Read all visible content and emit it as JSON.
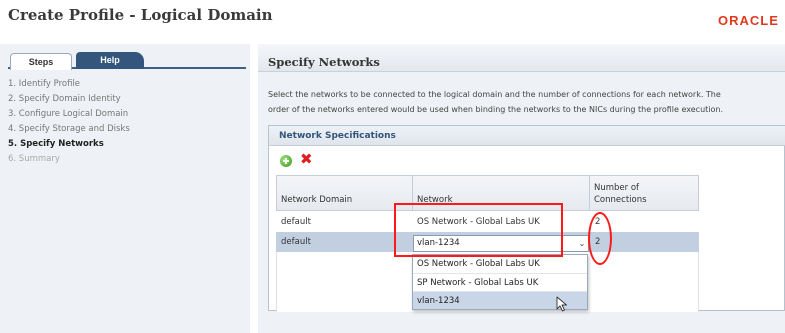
{
  "window": {
    "title": "Create Profile - Logical Domain",
    "logo": "ORACLE"
  },
  "left_panel": {
    "tabs": [
      {
        "label": "Steps",
        "selected": true
      },
      {
        "label": "Help",
        "selected": false
      }
    ],
    "steps": [
      {
        "label": "1.  Identify Profile",
        "state": "done"
      },
      {
        "label": "2.  Specify Domain Identity",
        "state": "done"
      },
      {
        "label": "3.  Configure Logical Domain",
        "state": "done"
      },
      {
        "label": "4.  Specify Storage and Disks",
        "state": "done"
      },
      {
        "label": "5.  Specify Networks",
        "state": "current"
      },
      {
        "label": "6.  Summary",
        "state": "disabled"
      }
    ]
  },
  "main": {
    "title": "Specify Networks",
    "description_line1": "Select the networks to be connected to the logical domain and the number of connections for each network. The",
    "description_line2": "order of the networks entered would be used when binding the networks to the NICs during the profile execution."
  },
  "table_panel": {
    "title": "Network Specifications",
    "toolbar": {
      "add_icon": "add-icon",
      "delete_icon": "delete-icon",
      "delete_glyph": "✖"
    },
    "columns": {
      "network_domain": "Network Domain",
      "network": "Network",
      "connections_line1": "Number of",
      "connections_line2": "Connections"
    },
    "rows": [
      {
        "network_domain": "default",
        "network": "OS Network - Global Labs UK",
        "connections": "2"
      },
      {
        "network_domain": "default",
        "network": "vlan-1234",
        "connections": "2",
        "selected": true
      }
    ],
    "combo": {
      "value": "vlan-1234",
      "caret": "⌄"
    },
    "dropdown_options": [
      "OS Network - Global Labs UK",
      "SP Network - Global Labs UK",
      "vlan-1234"
    ]
  },
  "colors": {
    "accent": "#34557c",
    "annotation": "#ff1a1a",
    "logo": "#e03a1e",
    "selected_row": "#c2cfe1"
  }
}
